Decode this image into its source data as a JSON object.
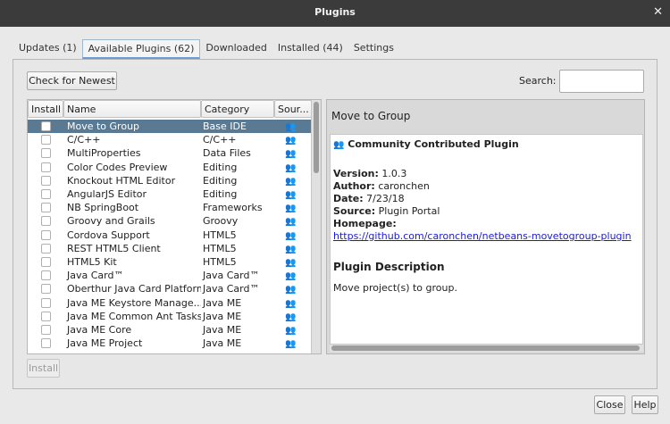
{
  "window": {
    "title": "Plugins",
    "close_glyph": "✕"
  },
  "tabs": [
    {
      "label": "Updates (1)"
    },
    {
      "label": "Available Plugins (62)",
      "active": true
    },
    {
      "label": "Downloaded"
    },
    {
      "label": "Installed (44)"
    },
    {
      "label": "Settings"
    }
  ],
  "toolbar": {
    "check_newest_label": "Check for Newest",
    "search_label": "Search:",
    "search_value": "",
    "install_label": "Install"
  },
  "table": {
    "headers": {
      "install": "Install",
      "name": "Name",
      "category": "Category",
      "source": "Sour..."
    },
    "rows": [
      {
        "name": "Move to Group",
        "category": "Base IDE",
        "selected": true
      },
      {
        "name": "C/C++",
        "category": "C/C++"
      },
      {
        "name": "MultiProperties",
        "category": "Data Files"
      },
      {
        "name": "Color Codes Preview",
        "category": "Editing"
      },
      {
        "name": "Knockout HTML Editor",
        "category": "Editing"
      },
      {
        "name": "AngularJS Editor",
        "category": "Editing"
      },
      {
        "name": "NB SpringBoot",
        "category": "Frameworks"
      },
      {
        "name": "Groovy and Grails",
        "category": "Groovy"
      },
      {
        "name": "Cordova Support",
        "category": "HTML5"
      },
      {
        "name": "REST HTML5 Client",
        "category": "HTML5"
      },
      {
        "name": "HTML5 Kit",
        "category": "HTML5"
      },
      {
        "name": "Java Card™",
        "category": "Java Card™"
      },
      {
        "name": "Oberthur Java Card Platform",
        "category": "Java Card™"
      },
      {
        "name": "Java ME Keystore Manage...",
        "category": "Java ME"
      },
      {
        "name": "Java ME Common Ant Tasks",
        "category": "Java ME"
      },
      {
        "name": "Java ME Core",
        "category": "Java ME"
      },
      {
        "name": "Java ME Project",
        "category": "Java ME"
      }
    ]
  },
  "detail": {
    "header": "Move to Group",
    "plugin_type": "Community Contributed Plugin",
    "version_label": "Version:",
    "version": "1.0.3",
    "author_label": "Author:",
    "author": "caronchen",
    "date_label": "Date:",
    "date": "7/23/18",
    "source_label": "Source:",
    "source": "Plugin Portal",
    "homepage_label": "Homepage:",
    "homepage": "https://github.com/caronchen/netbeans-movetogroup-plugin",
    "description_title": "Plugin Description",
    "description": "Move project(s) to group."
  },
  "footer": {
    "close_label": "Close",
    "help_label": "Help"
  },
  "icons": {
    "source": "community-people-icon"
  }
}
